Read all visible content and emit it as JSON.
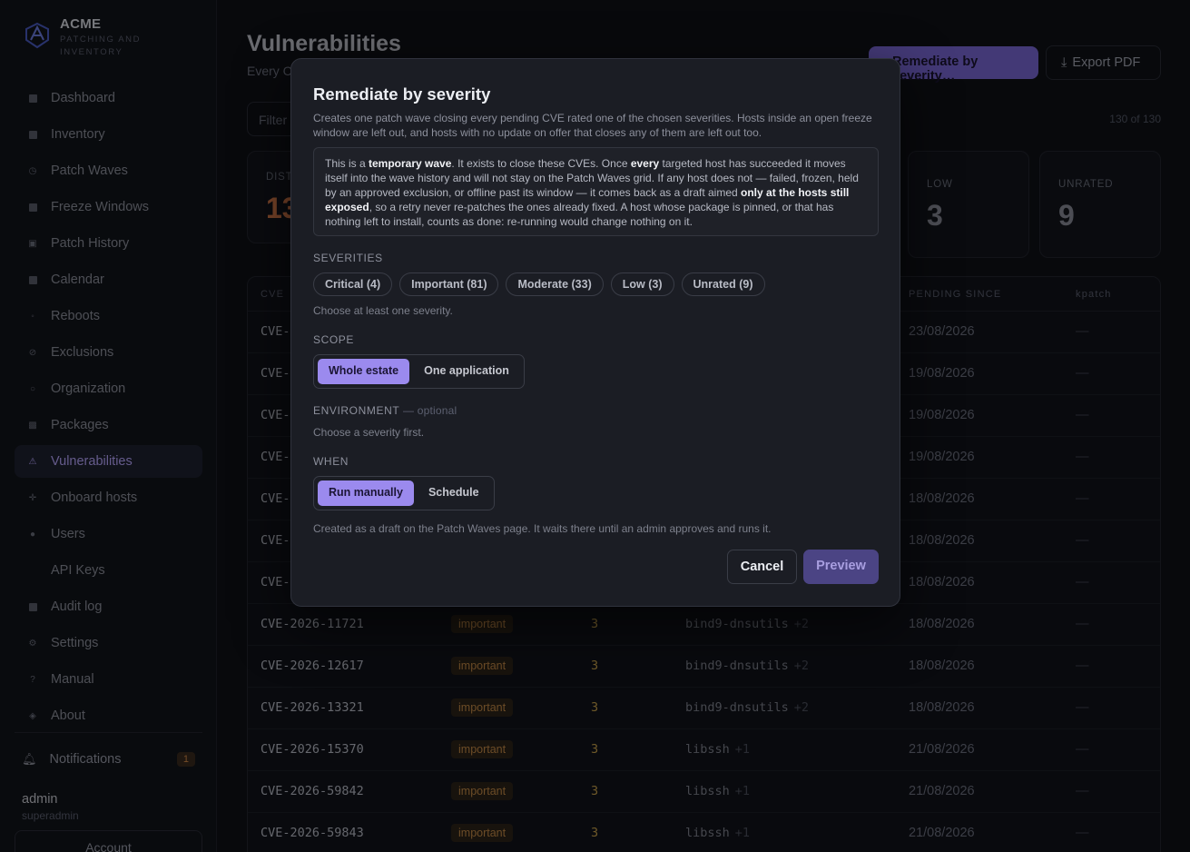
{
  "brand": {
    "name": "ACME",
    "subtitle": "PATCHING AND INVENTORY"
  },
  "sidebar": {
    "items": [
      {
        "label": "Dashboard",
        "icon": "grid-icon"
      },
      {
        "label": "Inventory",
        "icon": "box-icon"
      },
      {
        "label": "Patch Waves",
        "icon": "clock-icon"
      },
      {
        "label": "Freeze Windows",
        "icon": "snowflake-icon"
      },
      {
        "label": "Patch History",
        "icon": "history-icon"
      },
      {
        "label": "Calendar",
        "icon": "calendar-icon"
      },
      {
        "label": "Reboots",
        "icon": "reboot-icon"
      },
      {
        "label": "Exclusions",
        "icon": "ban-icon"
      },
      {
        "label": "Organization",
        "icon": "org-icon"
      },
      {
        "label": "Packages",
        "icon": "package-icon"
      },
      {
        "label": "Vulnerabilities",
        "icon": "warning-icon",
        "active": true
      },
      {
        "label": "Onboard hosts",
        "icon": "plus-icon"
      },
      {
        "label": "Users",
        "icon": "users-icon"
      },
      {
        "label": "API Keys",
        "icon": ""
      },
      {
        "label": "Audit log",
        "icon": "log-icon"
      },
      {
        "label": "Settings",
        "icon": "gear-icon"
      },
      {
        "label": "Manual",
        "icon": "question-icon"
      },
      {
        "label": "About",
        "icon": "info-icon"
      }
    ],
    "notifications": {
      "label": "Notifications",
      "count": "1"
    },
    "user": {
      "name": "admin",
      "role": "superadmin"
    },
    "account_label": "Account"
  },
  "page": {
    "title": "Vulnerabilities",
    "subtitle": "Every C",
    "remediate_label": "Remediate by severity…",
    "export_label": "Export PDF",
    "filter_placeholder": "Filter",
    "count": "130 of 130"
  },
  "stats": {
    "dist": {
      "label": "DIST",
      "value": "13"
    },
    "low": {
      "label": "LOW",
      "value": "3"
    },
    "unrated": {
      "label": "UNRATED",
      "value": "9"
    }
  },
  "table": {
    "headers": {
      "cve": "CVE",
      "pending_since": "PENDING SINCE",
      "kpatch": "kpatch"
    },
    "rows": [
      {
        "cve": "CVE-",
        "since": "23/08/2026",
        "kpatch": "—"
      },
      {
        "cve": "CVE-",
        "since": "19/08/2026",
        "kpatch": "—"
      },
      {
        "cve": "CVE-",
        "since": "19/08/2026",
        "kpatch": "—"
      },
      {
        "cve": "CVE-",
        "since": "19/08/2026",
        "kpatch": "—"
      },
      {
        "cve": "CVE-",
        "since": "18/08/2026",
        "kpatch": "—"
      },
      {
        "cve": "CVE-",
        "since": "18/08/2026",
        "kpatch": "—"
      },
      {
        "cve": "CVE-",
        "since": "18/08/2026",
        "kpatch": "—"
      },
      {
        "cve": "CVE-2026-11721",
        "severity": "important",
        "hosts": "3",
        "package": "bind9-dnsutils",
        "more": "+2",
        "since": "18/08/2026",
        "kpatch": "—"
      },
      {
        "cve": "CVE-2026-12617",
        "severity": "important",
        "hosts": "3",
        "package": "bind9-dnsutils",
        "more": "+2",
        "since": "18/08/2026",
        "kpatch": "—"
      },
      {
        "cve": "CVE-2026-13321",
        "severity": "important",
        "hosts": "3",
        "package": "bind9-dnsutils",
        "more": "+2",
        "since": "18/08/2026",
        "kpatch": "—"
      },
      {
        "cve": "CVE-2026-15370",
        "severity": "important",
        "hosts": "3",
        "package": "libssh",
        "more": "+1",
        "since": "21/08/2026",
        "kpatch": "—"
      },
      {
        "cve": "CVE-2026-59842",
        "severity": "important",
        "hosts": "3",
        "package": "libssh",
        "more": "+1",
        "since": "21/08/2026",
        "kpatch": "—"
      },
      {
        "cve": "CVE-2026-59843",
        "severity": "important",
        "hosts": "3",
        "package": "libssh",
        "more": "+1",
        "since": "21/08/2026",
        "kpatch": "—"
      }
    ]
  },
  "modal": {
    "title": "Remediate by severity",
    "description": "Creates one patch wave closing every pending CVE rated one of the chosen severities. Hosts inside an open freeze window are left out, and hosts with no update on offer that closes any of them are left out too.",
    "info": {
      "p1": "This is a ",
      "b1": "temporary wave",
      "p2": ". It exists to close these CVEs. Once ",
      "b2": "every",
      "p3": " targeted host has succeeded it moves itself into the wave history and will not stay on the Patch Waves grid. If any host does not — failed, frozen, held by an approved exclusion, or offline past its window — it comes back as a draft aimed ",
      "b3": "only at the hosts still exposed",
      "p4": ", so a retry never re-patches the ones already fixed. A host whose package is pinned, or that has nothing left to install, counts as done: re-running would change nothing on it."
    },
    "severities_label": "SEVERITIES",
    "severities": [
      "Critical (4)",
      "Important (81)",
      "Moderate (33)",
      "Low (3)",
      "Unrated (9)"
    ],
    "severities_hint": "Choose at least one severity.",
    "scope_label": "SCOPE",
    "scope_options": [
      "Whole estate",
      "One application"
    ],
    "environment_label": "ENVIRONMENT",
    "environment_optional": "— optional",
    "environment_hint": "Choose a severity first.",
    "when_label": "WHEN",
    "when_options": [
      "Run manually",
      "Schedule"
    ],
    "when_hint": "Created as a draft on the Patch Waves page. It waits there until an admin approves and runs it.",
    "cancel_label": "Cancel",
    "preview_label": "Preview"
  }
}
